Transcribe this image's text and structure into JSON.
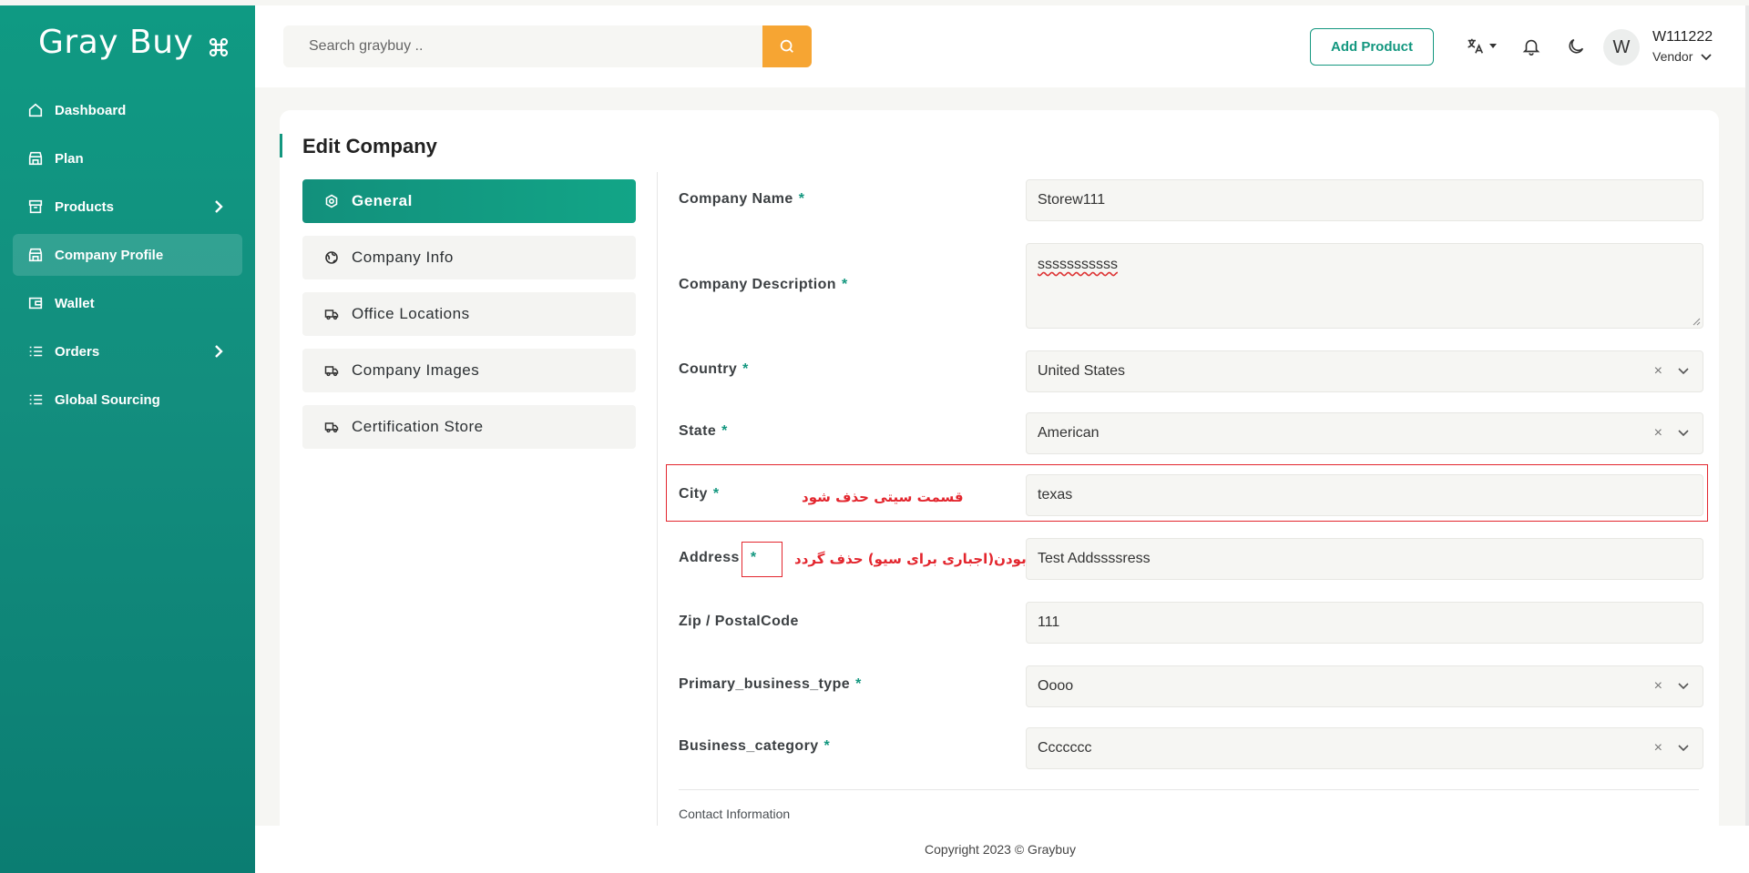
{
  "brand": {
    "name": "Gray Buy",
    "icon": "command-icon"
  },
  "sidebar": {
    "items": [
      {
        "label": "Dashboard",
        "icon": "home-icon",
        "has_chevron": false,
        "active": false
      },
      {
        "label": "Plan",
        "icon": "store-icon",
        "has_chevron": false,
        "active": false
      },
      {
        "label": "Products",
        "icon": "archive-icon",
        "has_chevron": true,
        "active": false
      },
      {
        "label": "Company Profile",
        "icon": "store-icon",
        "has_chevron": false,
        "active": true
      },
      {
        "label": "Wallet",
        "icon": "wallet-icon",
        "has_chevron": false,
        "active": false
      },
      {
        "label": "Orders",
        "icon": "list-icon",
        "has_chevron": true,
        "active": false
      },
      {
        "label": "Global Sourcing",
        "icon": "list-icon",
        "has_chevron": false,
        "active": false
      }
    ]
  },
  "topbar": {
    "search_placeholder": "Search graybuy ..",
    "add_product_label": "Add Product",
    "avatar_initial": "W",
    "user_name": "W111222",
    "user_role": "Vendor"
  },
  "page": {
    "title": "Edit Company",
    "tabs": [
      {
        "label": "General",
        "icon": "settings-icon",
        "active": true
      },
      {
        "label": "Company Info",
        "icon": "globe-icon",
        "active": false
      },
      {
        "label": "Office Locations",
        "icon": "truck-icon",
        "active": false
      },
      {
        "label": "Company Images",
        "icon": "truck-icon",
        "active": false
      },
      {
        "label": "Certification Store",
        "icon": "truck-icon",
        "active": false
      }
    ]
  },
  "form": {
    "company_name": {
      "label": "Company Name",
      "required": "*",
      "value": "Storew111"
    },
    "company_description": {
      "label": "Company Description",
      "required": "*",
      "value": "sssssssssss"
    },
    "country": {
      "label": "Country",
      "required": "*",
      "value": "United States",
      "clear": "×"
    },
    "state": {
      "label": "State",
      "required": "*",
      "value": "American",
      "clear": "×"
    },
    "city": {
      "label": "City",
      "required": "*",
      "value": "texas"
    },
    "address": {
      "label": "Address",
      "required": "*",
      "value": "Test Addssssress"
    },
    "zip": {
      "label": "Zip / PostalCode",
      "value": "111"
    },
    "primary_business_type": {
      "label": "Primary_business_type",
      "required": "*",
      "value": "Oooo",
      "clear": "×"
    },
    "business_category": {
      "label": "Business_category",
      "required": "*",
      "value": "Ccccccc",
      "clear": "×"
    },
    "contact_section": "Contact Information"
  },
  "annotations": {
    "city_note": "قسمت سیتی حذف شود",
    "address_note": "ستاره بودن(اجباری برای سیو) حذف گردد",
    "color": "#e3262e"
  },
  "footer": {
    "copyright": "Copyright 2023 © Graybuy"
  },
  "colors": {
    "primary": "#13977f",
    "accent": "#f6a533"
  }
}
